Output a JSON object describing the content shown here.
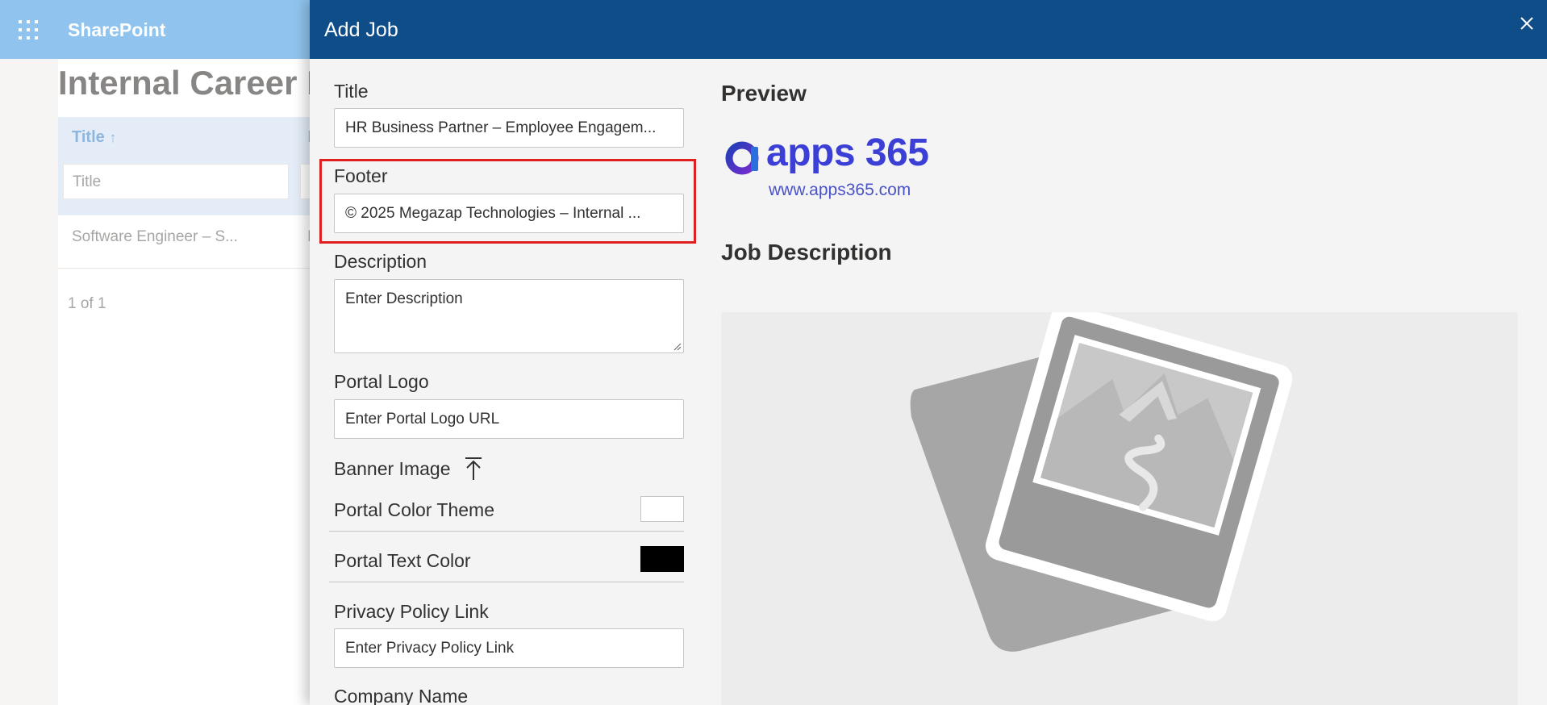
{
  "app": {
    "brand": "SharePoint"
  },
  "background_page": {
    "page_title": "Internal Career P",
    "grid": {
      "column_title": "Title",
      "sort_glyph": "↑",
      "second_column_glyph": "I",
      "filter_placeholder": "Title",
      "rows": [
        {
          "title": "Software Engineer – S...",
          "second_glyph": "I"
        }
      ]
    },
    "pager": "1 of 1"
  },
  "panel": {
    "title": "Add Job",
    "form": {
      "title_label": "Title",
      "title_value": "HR Business Partner – Employee Engagem...",
      "footer_label": "Footer",
      "footer_value": "© 2025 Megazap Technologies – Internal ...",
      "description_label": "Description",
      "description_placeholder": "Enter Description",
      "portal_logo_label": "Portal Logo",
      "portal_logo_placeholder": "Enter Portal Logo URL",
      "banner_image_label": "Banner Image",
      "portal_color_theme_label": "Portal Color Theme",
      "portal_color_theme_value": "#ffffff",
      "portal_text_color_label": "Portal Text Color",
      "portal_text_color_value": "#000000",
      "privacy_policy_label": "Privacy Policy Link",
      "privacy_policy_placeholder": "Enter Privacy Policy Link",
      "company_name_label": "Company Name"
    },
    "preview": {
      "heading": "Preview",
      "logo_text": "apps 365",
      "logo_url": "www.apps365.com",
      "job_description_heading": "Job Description"
    }
  },
  "colors": {
    "sp_header": "#6bb1e9",
    "panel_header": "#0f4d89",
    "highlight": "#e02020",
    "logo": "#3b3fd6"
  },
  "icons": [
    "waffle-icon",
    "close-icon",
    "upload-icon",
    "apps365-logo-icon",
    "image-placeholder-icon"
  ]
}
